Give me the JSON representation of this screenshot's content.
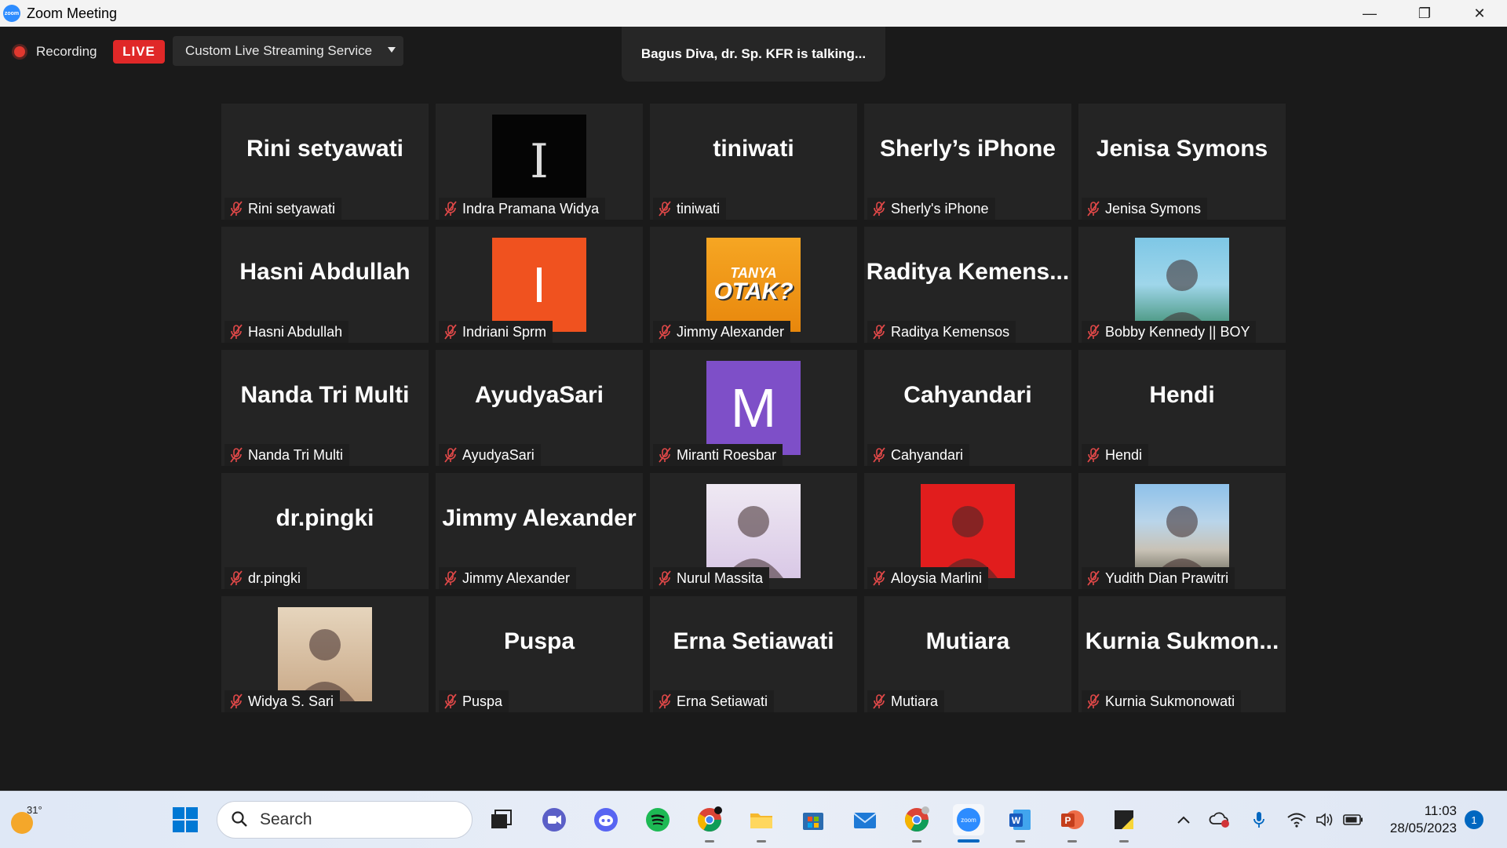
{
  "window": {
    "title": "Zoom Meeting",
    "app_icon_text": "zoom",
    "minimize": "—",
    "restore": "❐",
    "close": "✕"
  },
  "topbar": {
    "recording_label": "Recording",
    "live_badge": "LIVE",
    "stream_service": "Custom Live Streaming Service",
    "talking_indicator": "Bagus Diva, dr. Sp. KFR is talking..."
  },
  "participants": [
    {
      "big": "Rini setyawati",
      "label": "Rini setyawati"
    },
    {
      "avatar_text": "I",
      "label": "Indra Pramana Widya"
    },
    {
      "big": "tiniwati",
      "label": "tiniwati"
    },
    {
      "big": "Sherly’s iPhone",
      "label": "Sherly's iPhone"
    },
    {
      "big": "Jenisa Symons",
      "label": "Jenisa Symons"
    },
    {
      "big": "Hasni Abdullah",
      "label": "Hasni Abdullah"
    },
    {
      "avatar_text": "I",
      "label": "Indriani Sprm"
    },
    {
      "avatar_text": "TANYA",
      "avatar_text2": "OTAK?",
      "label": "Jimmy Alexander"
    },
    {
      "big": "Raditya  Kemens...",
      "label": "Raditya Kemensos"
    },
    {
      "label": "Bobby Kennedy || BOY"
    },
    {
      "big": "Nanda Tri Multi",
      "label": "Nanda Tri Multi"
    },
    {
      "big": "AyudyaSari",
      "label": "AyudyaSari"
    },
    {
      "avatar_text": "M",
      "label": "Miranti Roesbar"
    },
    {
      "big": "Cahyandari",
      "label": "Cahyandari"
    },
    {
      "big": "Hendi",
      "label": "Hendi"
    },
    {
      "big": "dr.pingki",
      "label": "dr.pingki"
    },
    {
      "big": "Jimmy Alexander",
      "label": "Jimmy Alexander"
    },
    {
      "label": "Nurul Massita"
    },
    {
      "label": "Aloysia Marlini"
    },
    {
      "label": "Yudith Dian Prawitri"
    },
    {
      "label": "Widya S. Sari"
    },
    {
      "big": "Puspa",
      "label": "Puspa"
    },
    {
      "big": "Erna Setiawati",
      "label": "Erna Setiawati"
    },
    {
      "big": "Mutiara",
      "label": "Mutiara"
    },
    {
      "big": "Kurnia  Sukmon...",
      "label": "Kurnia Sukmonowati"
    }
  ],
  "taskbar": {
    "weather_temp": "31°",
    "search_placeholder": "Search",
    "clock_time": "11:03",
    "clock_date": "28/05/2023",
    "notification_count": "1",
    "zoom_icon_text": "zoom",
    "word_icon_text": "W",
    "powerpoint_icon_text": "P"
  },
  "colors": {
    "live": "#e02828",
    "zoom_blue": "#2d8cff",
    "mute_red": "#e04848"
  }
}
